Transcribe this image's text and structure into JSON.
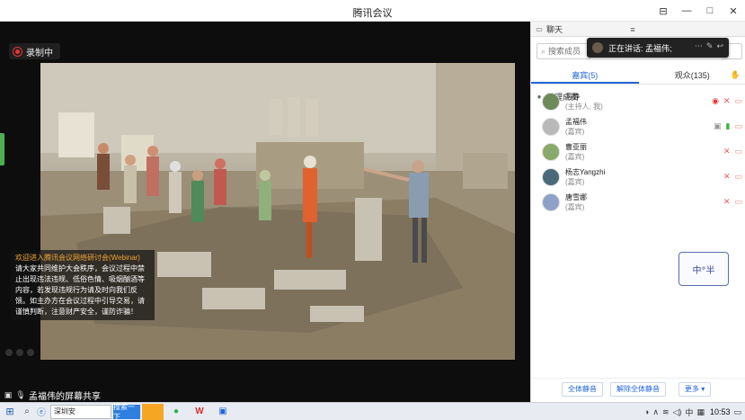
{
  "window": {
    "title": "腾讯会议",
    "buttons": {
      "pin": "⊟",
      "minimize": "—",
      "maximize": "□",
      "close": "✕"
    }
  },
  "stage": {
    "recording_label": "录制中",
    "notice": {
      "title": "欢迎进入腾讯会议网络研讨会(Webinar)",
      "body": "请大家共同维护大会秩序，会议过程中禁止出现违法违规、低俗色情、吸烟酗酒等内容，若发现违规行为请及时向我们反馈。如主办方在会议过程中引导交易，请谨慎判断，注意财产安全，谨防诈骗！"
    },
    "share_label": "孟福伟的屏幕共享"
  },
  "panel": {
    "tabs": {
      "chat": "聊天",
      "members": "管理成员"
    },
    "search_placeholder": "搜索成员",
    "speaking": "正在讲话: 孟福伟;",
    "role_tabs": {
      "guests": "嘉宾(5)",
      "audience": "观众(135)"
    },
    "members": [
      {
        "name": "冯静",
        "role": "(主持人, 我)",
        "avatar": "#6e8a5a"
      },
      {
        "name": "孟福伟",
        "role": "(嘉宾)",
        "avatar": "#b9b9b9"
      },
      {
        "name": "曹亚丽",
        "role": "(嘉宾)",
        "avatar": "#8aa96a"
      },
      {
        "name": "杨志Yangzhi",
        "role": "(嘉宾)",
        "avatar": "#4a6a7a"
      },
      {
        "name": "唐雪娜",
        "role": "(嘉宾)",
        "avatar": "#8ea2c8"
      }
    ],
    "stamp": "中°半",
    "buttons": {
      "mute_all": "全体静音",
      "unmute_all": "解除全体静音",
      "more": "更多 ▾"
    }
  },
  "taskbar": {
    "search_text": "深圳安",
    "search_button": "搜索一下",
    "clock": "10:53"
  },
  "colors": {
    "accent": "#2166d9",
    "record": "#e33333",
    "notice_title": "#f3a533"
  }
}
